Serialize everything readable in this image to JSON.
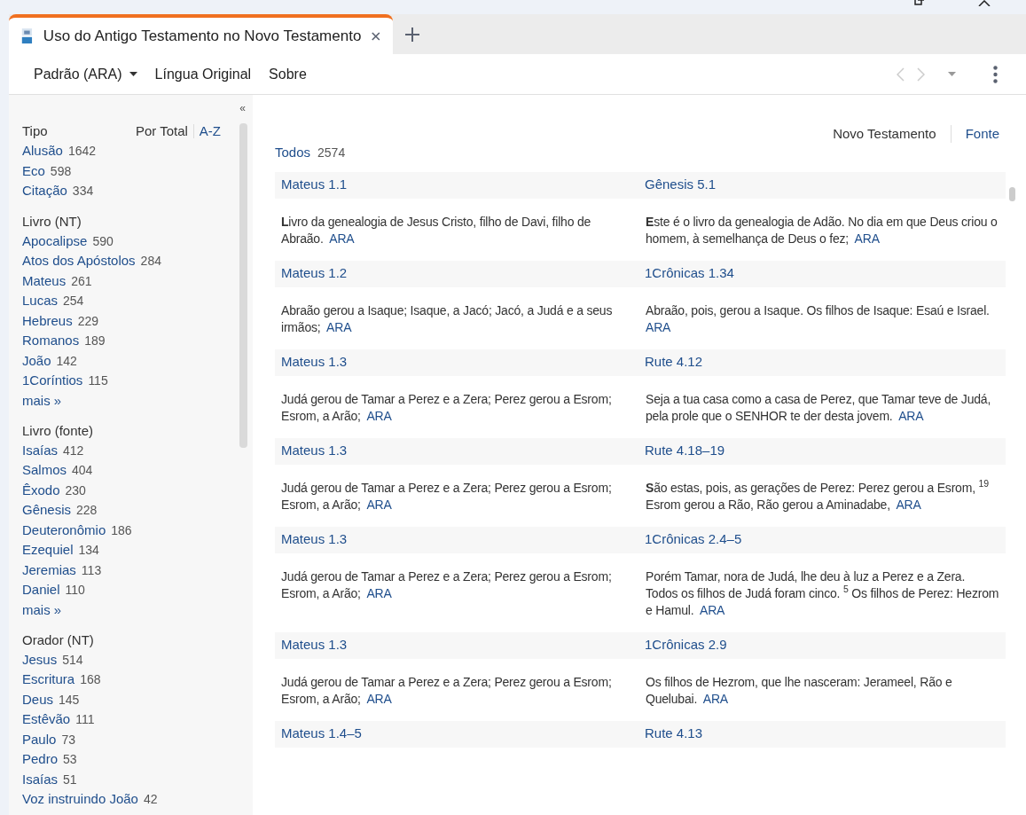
{
  "tab": {
    "title": "Uso do Antigo Testamento no Novo Testamento",
    "selected": true
  },
  "toolbar": {
    "menus": [
      {
        "label": "Padrão (ARA)",
        "dropdown": true
      },
      {
        "label": "Língua Original",
        "dropdown": false
      },
      {
        "label": "Sobre",
        "dropdown": false
      }
    ]
  },
  "sidebar": {
    "collapse": "«",
    "sort_options": [
      {
        "label": "Por Total",
        "selected": true
      },
      {
        "label": "A-Z",
        "selected": false
      }
    ],
    "groups": [
      {
        "title": "Tipo",
        "items": [
          {
            "label": "Alusão",
            "count": "1642"
          },
          {
            "label": "Eco",
            "count": "598"
          },
          {
            "label": "Citação",
            "count": "334"
          }
        ]
      },
      {
        "title": "Livro (NT)",
        "items": [
          {
            "label": "Apocalipse",
            "count": "590"
          },
          {
            "label": "Atos dos Apóstolos",
            "count": "284"
          },
          {
            "label": "Mateus",
            "count": "261"
          },
          {
            "label": "Lucas",
            "count": "254"
          },
          {
            "label": "Hebreus",
            "count": "229"
          },
          {
            "label": "Romanos",
            "count": "189"
          },
          {
            "label": "João",
            "count": "142"
          },
          {
            "label": "1Coríntios",
            "count": "115"
          }
        ],
        "more": "mais »"
      },
      {
        "title": "Livro (fonte)",
        "items": [
          {
            "label": "Isaías",
            "count": "412"
          },
          {
            "label": "Salmos",
            "count": "404"
          },
          {
            "label": "Êxodo",
            "count": "230"
          },
          {
            "label": "Gênesis",
            "count": "228"
          },
          {
            "label": "Deuteronômio",
            "count": "186"
          },
          {
            "label": "Ezequiel",
            "count": "134"
          },
          {
            "label": "Jeremias",
            "count": "113"
          },
          {
            "label": "Daniel",
            "count": "110"
          }
        ],
        "more": "mais »"
      },
      {
        "title": "Orador (NT)",
        "items": [
          {
            "label": "Jesus",
            "count": "514"
          },
          {
            "label": "Escritura",
            "count": "168"
          },
          {
            "label": "Deus",
            "count": "145"
          },
          {
            "label": "Estêvão",
            "count": "111"
          },
          {
            "label": "Paulo",
            "count": "73"
          },
          {
            "label": "Pedro",
            "count": "53"
          },
          {
            "label": "Isaías",
            "count": "51"
          },
          {
            "label": "Voz instruindo João",
            "count": "42"
          }
        ]
      }
    ]
  },
  "main": {
    "views": [
      {
        "label": "Novo Testamento",
        "selected": true
      },
      {
        "label": "Fonte",
        "selected": false
      }
    ],
    "total": {
      "label": "Todos",
      "count": "2574"
    },
    "rows": [
      {
        "nt_ref": "Mateus 1.1",
        "ot_ref": "Gênesis 5.1",
        "nt_text": "**L**ivro da genealogia de Jesus Cristo, filho de Davi, filho de Abraão.",
        "nt_version": "ARA",
        "ot_text": "**E**ste é o livro da genealogia de Adão. No dia em que Deus criou o homem, à semelhança de Deus o fez;",
        "ot_version": "ARA"
      },
      {
        "nt_ref": "Mateus 1.2",
        "ot_ref": "1Crônicas 1.34",
        "nt_text": "Abraão gerou a Isaque; Isaque, a Jacó; Jacó, a Judá e a seus irmãos;",
        "nt_version": "ARA",
        "ot_text": "Abraão, pois, gerou a Isaque. Os filhos de Isaque: Esaú e Israel.",
        "ot_version": "ARA"
      },
      {
        "nt_ref": "Mateus 1.3",
        "ot_ref": "Rute 4.12",
        "nt_text": "Judá gerou de Tamar a Perez e a Zera; Perez gerou a Esrom; Esrom, a Arão;",
        "nt_version": "ARA",
        "ot_text": "Seja a tua casa como a casa de Perez, que Tamar teve de Judá, pela prole que o SENHOR te der desta jovem.",
        "ot_version": "ARA"
      },
      {
        "nt_ref": "Mateus 1.3",
        "ot_ref": "Rute 4.18–19",
        "nt_text": "Judá gerou de Tamar a Perez e a Zera; Perez gerou a Esrom; Esrom, a Arão;",
        "nt_version": "ARA",
        "ot_text": "**S**ão estas, pois, as gerações de Perez: Perez gerou a Esrom, $^{19}$ Esrom gerou a Rão, Rão gerou a Aminadabe,",
        "ot_version": "ARA"
      },
      {
        "nt_ref": "Mateus 1.3",
        "ot_ref": "1Crônicas 2.4–5",
        "nt_text": "Judá gerou de Tamar a Perez e a Zera; Perez gerou a Esrom; Esrom, a Arão;",
        "nt_version": "ARA",
        "ot_text": "Porém Tamar, nora de Judá, lhe deu à luz a Perez e a Zera. Todos os filhos de Judá foram cinco. $^{5}$ Os filhos de Perez: Hezrom e Hamul.",
        "ot_version": "ARA"
      },
      {
        "nt_ref": "Mateus 1.3",
        "ot_ref": "1Crônicas 2.9",
        "nt_text": "Judá gerou de Tamar a Perez e a Zera; Perez gerou a Esrom; Esrom, a Arão;",
        "nt_version": "ARA",
        "ot_text": "Os filhos de Hezrom, que lhe nasceram: Jerameel, Rão e Quelubai.",
        "ot_version": "ARA"
      },
      {
        "nt_ref": "Mateus 1.4–5",
        "ot_ref": "Rute 4.13"
      }
    ]
  }
}
